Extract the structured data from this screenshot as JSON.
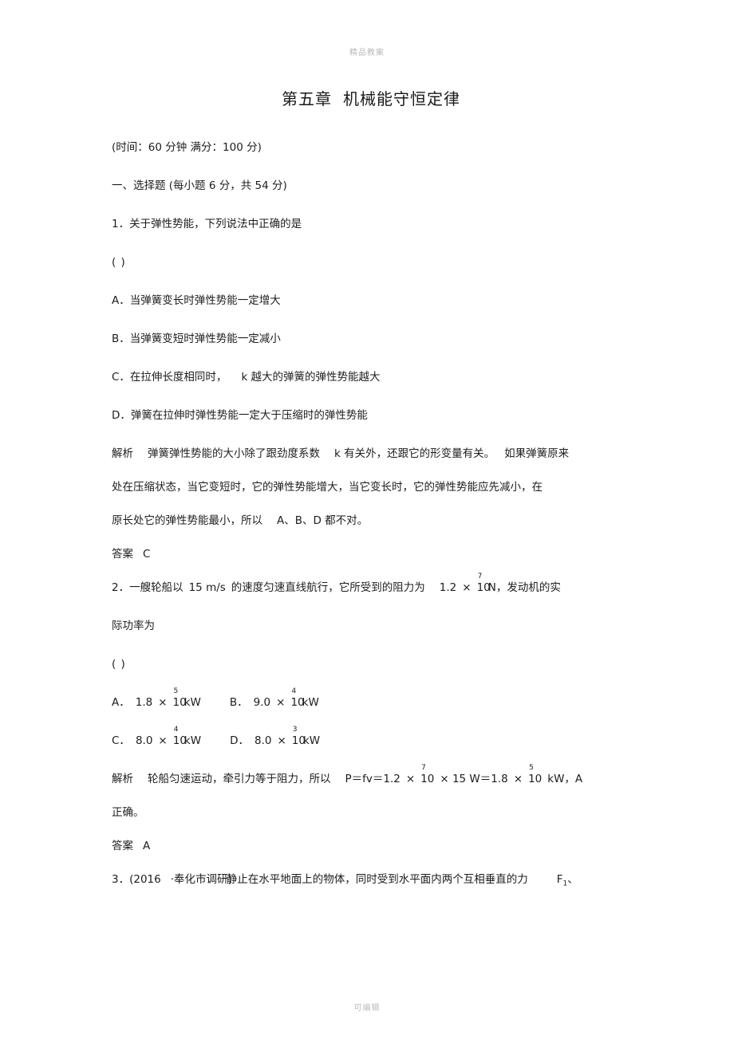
{
  "watermark": {
    "top": "精品教案",
    "bottom": "可编辑"
  },
  "title": {
    "chapter": "第五章",
    "name": "机械能守恒定律"
  },
  "meta": {
    "exam_info": "(时间：60 分钟    满分：100 分)",
    "section_heading": "一、选择题 (每小题 6 分，共 54 分)"
  },
  "questions": [
    {
      "number": "1．",
      "stem": "关于弹性势能，下列说法中正确的是",
      "answer_blank": "(    )",
      "options": [
        "A．当弹簧变长时弹性势能一定增大",
        "B．当弹簧变短时弹性势能一定减小",
        "C．在拉伸长度相同时，",
        "D．弹簧在拉伸时弹性势能一定大于压缩时的弹性势能"
      ],
      "option_c_tail": "k 越大的弹簧的弹性势能越大",
      "analysis_label": "解析",
      "analysis_line1_a": "弹簧弹性势能的大小除了跟劲度系数",
      "analysis_line1_b": "k 有关外，还跟它的形变量有关。",
      "analysis_line1_c": "如果弹簧原来",
      "analysis_line2": "处在压缩状态，当它变短时，它的弹性势能增大，当它变长时，它的弹性势能应先减小，在",
      "analysis_line3_a": "原长处它的弹性势能最小，所以",
      "analysis_line3_b": "A、B、D 都不对。",
      "answer_label": "答案",
      "answer_value": "C"
    },
    {
      "number": "2．",
      "stem_a": "一艘轮船以",
      "stem_speed": "15 m/s",
      "stem_b": "的速度匀速直线航行，它所受到的阻力为",
      "stem_force_mantissa": "1.2",
      "stem_force_times": "×",
      "stem_force_base": "10",
      "stem_force_exp": "7",
      "stem_force_unit": "N",
      "stem_c": "，发动机的实",
      "stem_line2": "际功率为",
      "answer_blank": "(    )",
      "options": [
        {
          "label": "A．",
          "mantissa": "1.8",
          "times": "×",
          "base": "10",
          "exp": "5",
          "unit": "kW"
        },
        {
          "label": "B．",
          "mantissa": "9.0",
          "times": "×",
          "base": "10",
          "exp": "4",
          "unit": "kW"
        },
        {
          "label": "C．",
          "mantissa": "8.0",
          "times": "×",
          "base": "10",
          "exp": "4",
          "unit": "kW"
        },
        {
          "label": "D．",
          "mantissa": "8.0",
          "times": "×",
          "base": "10",
          "exp": "3",
          "unit": "kW"
        }
      ],
      "analysis_label": "解析",
      "analysis_a": "轮船匀速运动，牵引力等于阻力，所以",
      "analysis_formula_1": "P＝fv＝1.2",
      "analysis_formula_times1": "×",
      "analysis_formula_base1": "10",
      "analysis_formula_exp1": "7",
      "analysis_formula_2": "× 15 W＝1.8",
      "analysis_formula_times2": "×",
      "analysis_formula_base2": "10",
      "analysis_formula_exp2": "5",
      "analysis_formula_unit": "kW",
      "analysis_tail": "，A",
      "analysis_line2": "正确。",
      "answer_label": "答案",
      "answer_value": "A"
    },
    {
      "number": "3．",
      "source": "(2016",
      "source_mid": "·奉化市调研)",
      "stem": "静止在水平地面上的物体，同时受到水平面内两个互相垂直的力",
      "force_symbol": "F",
      "force_sub": "1",
      "stem_tail": "、"
    }
  ]
}
